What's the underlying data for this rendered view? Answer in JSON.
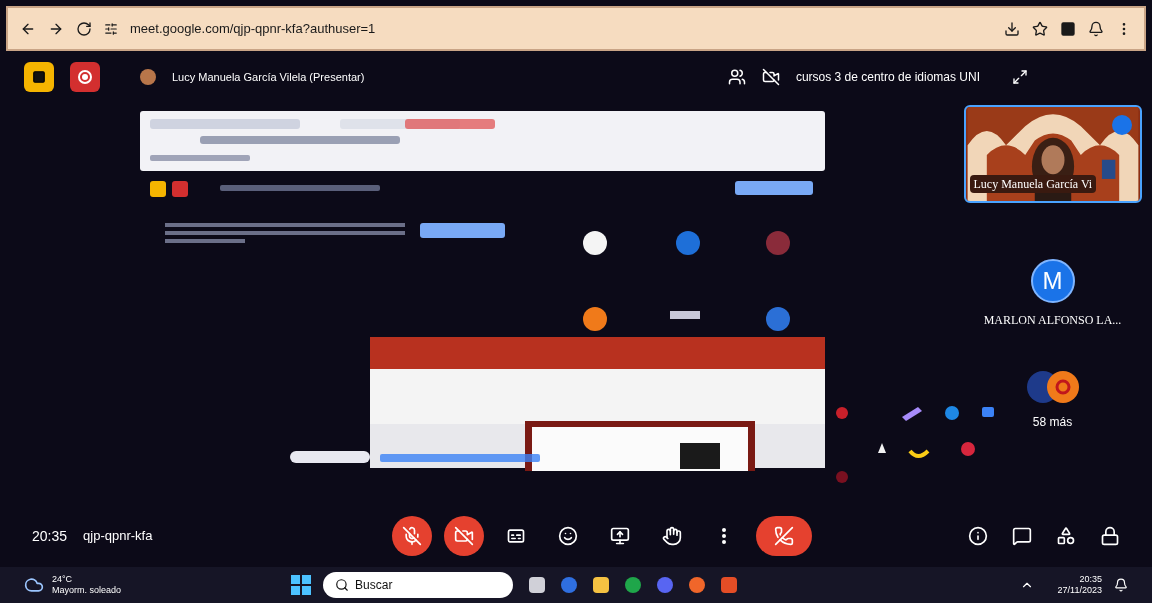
{
  "browser": {
    "url": "meet.google.com/qjp-qpnr-kfa?authuser=1"
  },
  "meeting": {
    "presenter_label": "Lucy Manuela García Vilela (Presentar)",
    "title": "cursos 3 de centro de idiomas UNI",
    "time": "20:35",
    "code": "qjp-qpnr-kfa"
  },
  "participants": [
    {
      "kind": "video",
      "name": "Lucy Manuela García Vi"
    },
    {
      "kind": "avatar",
      "initial": "M",
      "name": "MARLON ALFONSO LA..."
    }
  ],
  "more": {
    "label": "58 más"
  },
  "controls": [
    {
      "kind": "mic",
      "off": true
    },
    {
      "kind": "camera",
      "off": true
    },
    {
      "kind": "captions",
      "off": false
    },
    {
      "kind": "emoji",
      "off": false
    },
    {
      "kind": "present",
      "off": false
    },
    {
      "kind": "hand",
      "off": false
    },
    {
      "kind": "more",
      "off": false
    },
    {
      "kind": "hangup"
    }
  ],
  "taskbar": {
    "weather_temp": "24°C",
    "weather_text": "Mayorm. soleado",
    "search_placeholder": "Buscar",
    "time": "20:35",
    "date": "27/11/2023"
  }
}
